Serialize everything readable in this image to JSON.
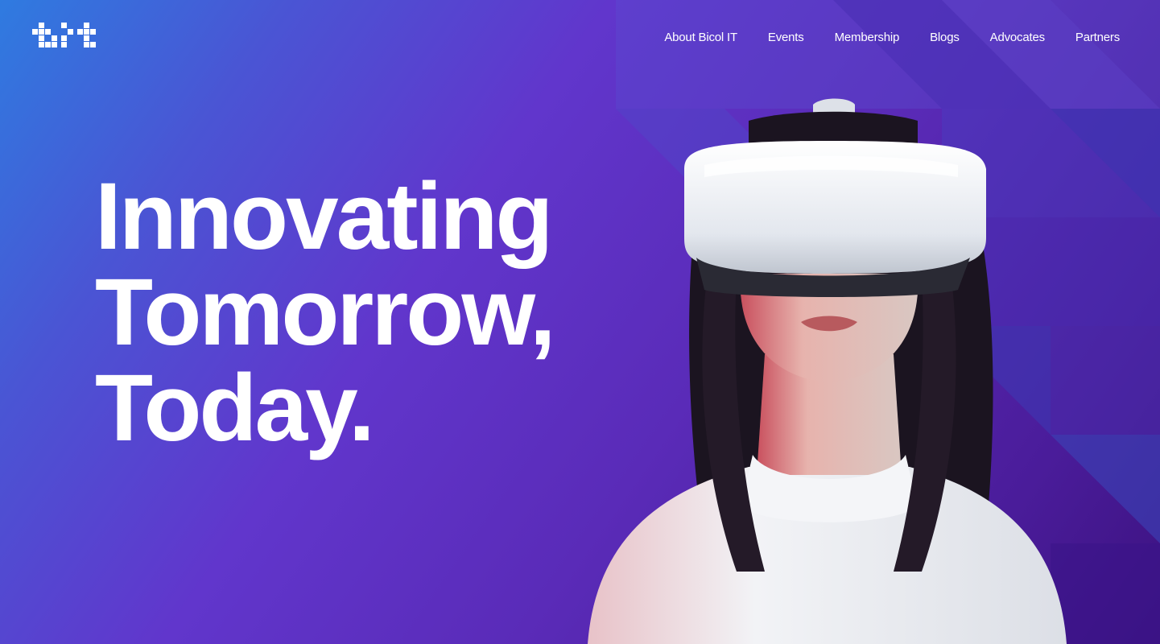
{
  "logo": {
    "icon": "bit-pixel-logo",
    "color": "#ffffff"
  },
  "nav": {
    "items": [
      {
        "label": "About Bicol IT"
      },
      {
        "label": "Events"
      },
      {
        "label": "Membership"
      },
      {
        "label": "Blogs"
      },
      {
        "label": "Advocates"
      },
      {
        "label": "Partners"
      }
    ]
  },
  "hero": {
    "headline": {
      "line1": "Innovating",
      "line2": "Tomorrow,",
      "line3": "Today."
    },
    "image": {
      "icon": "vr-headset-woman-image"
    }
  },
  "colors": {
    "gradient_start": "#2f7be0",
    "gradient_mid": "#6136cc",
    "gradient_end": "#3c1280",
    "text": "#ffffff",
    "headset": "#e9edf2",
    "sweater": "#eef0f3",
    "hair": "#1b1420"
  }
}
